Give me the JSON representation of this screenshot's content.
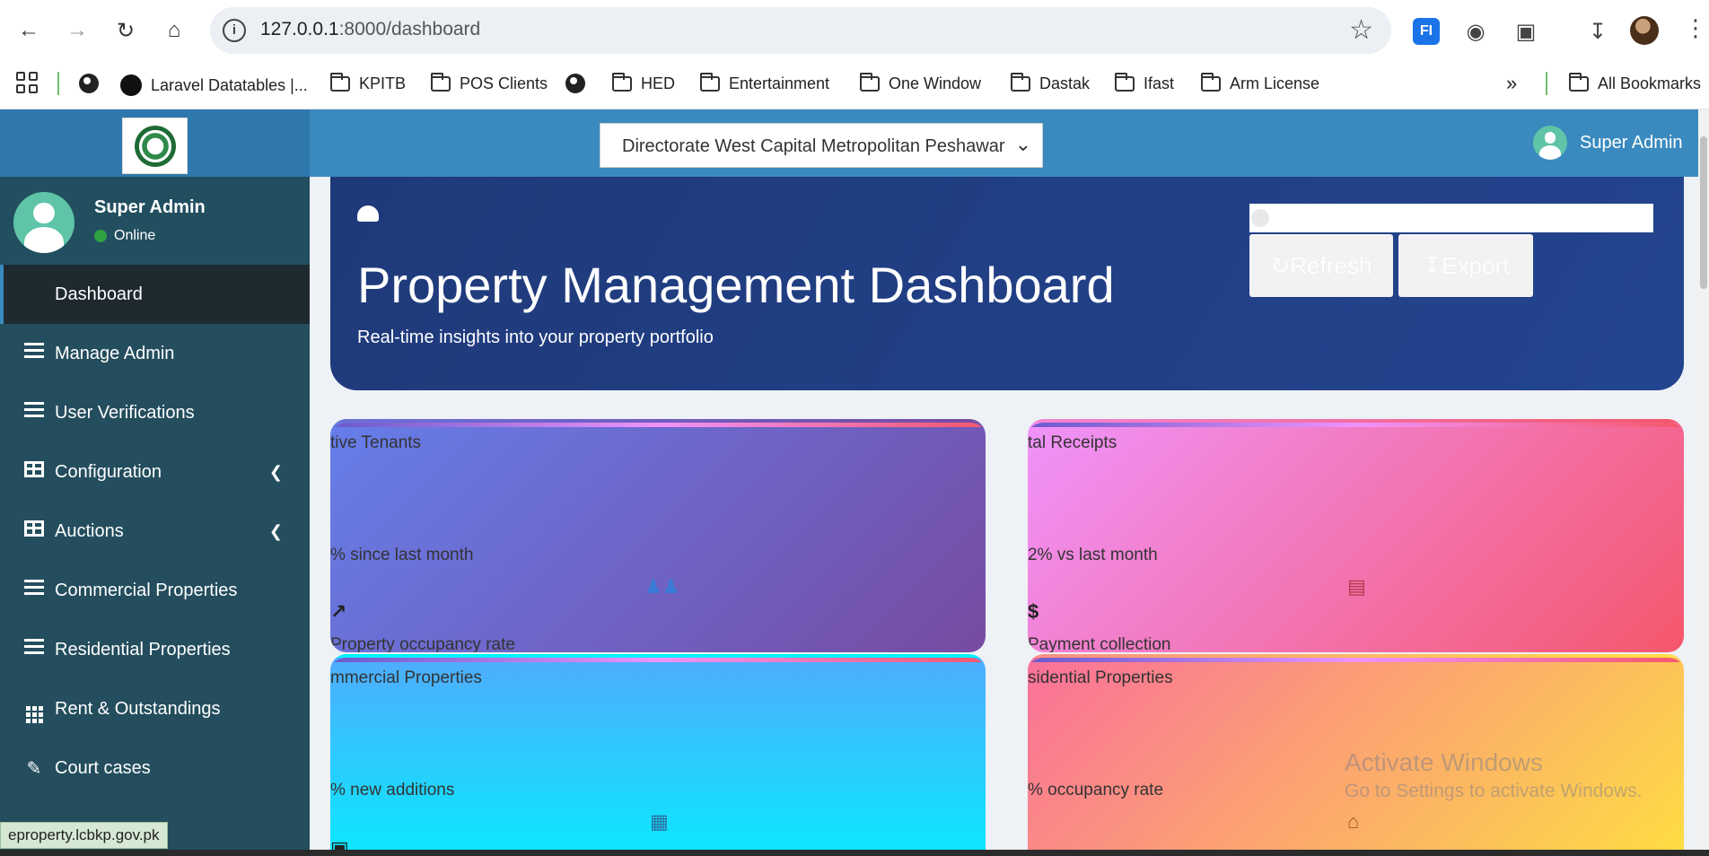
{
  "browser": {
    "url_host": "127.0.0.1",
    "url_path": ":8000/dashboard",
    "extension_label": "FI",
    "bookmarks": [
      {
        "label": "Laravel Datatables |...",
        "icon": "github-icon"
      },
      {
        "label": "KPITB",
        "icon": "folder-icon"
      },
      {
        "label": "POS Clients",
        "icon": "folder-icon"
      },
      {
        "label": "HED",
        "icon": "folder-icon"
      },
      {
        "label": "Entertainment",
        "icon": "folder-icon"
      },
      {
        "label": "One Window",
        "icon": "folder-icon"
      },
      {
        "label": "Dastak",
        "icon": "folder-icon"
      },
      {
        "label": "Ifast",
        "icon": "folder-icon"
      },
      {
        "label": "Arm License",
        "icon": "folder-icon"
      }
    ],
    "all_bookmarks_label": "All Bookmarks",
    "status_url": "eproperty.lcbkp.gov.pk"
  },
  "header": {
    "directorate_selected": "Directorate West Capital Metropolitan Peshawar",
    "user_name": "Super Admin"
  },
  "sidebar": {
    "user_name": "Super Admin",
    "user_status": "Online",
    "items": [
      {
        "label": "Dashboard",
        "icon": "none",
        "active": true
      },
      {
        "label": "Manage Admin",
        "icon": "list-icon"
      },
      {
        "label": "User Verifications",
        "icon": "list-icon"
      },
      {
        "label": "Configuration",
        "icon": "table-icon",
        "has_caret": true
      },
      {
        "label": "Auctions",
        "icon": "table-icon",
        "has_caret": true
      },
      {
        "label": "Commercial Properties",
        "icon": "list-icon"
      },
      {
        "label": "Residential Properties",
        "icon": "list-icon"
      },
      {
        "label": "Rent & Outstandings",
        "icon": "grid-icon"
      },
      {
        "label": "Court cases",
        "icon": "edit-icon"
      }
    ]
  },
  "hero": {
    "title": "Property Management Dashboard",
    "subtitle": "Real-time insights into your property portfolio",
    "refresh_label": "Refresh",
    "export_label": "Export"
  },
  "cards": [
    {
      "title": "tive Tenants",
      "trend": "% since last month",
      "desc": "Property occupancy rate",
      "card_icon": "users-icon",
      "side_icon": "chart-line-icon"
    },
    {
      "title": "tal Receipts",
      "trend": "2% vs last month",
      "desc": "Payment collection",
      "card_icon": "receipt-icon",
      "side_icon": "dollar-icon"
    },
    {
      "title": "mmercial Properties",
      "trend": "% new additions",
      "card_icon": "building-icon",
      "side_icon": "briefcase-icon"
    },
    {
      "title": "sidential Properties",
      "trend": "% occupancy rate",
      "card_icon": "home-icon"
    }
  ],
  "watermark": {
    "line1": "Activate Windows",
    "line2": "Go to Settings to activate Windows."
  },
  "colors": {
    "topbar": "#3a8abf",
    "sidebar": "#244e5e",
    "hero": "#23448f",
    "online": "#2ea043"
  }
}
